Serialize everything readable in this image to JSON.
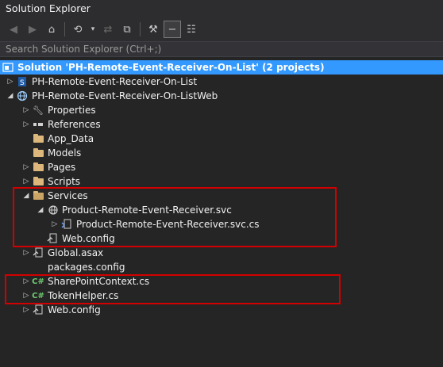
{
  "window": {
    "title": "Solution Explorer"
  },
  "toolbar": {
    "buttons": [
      "back-icon",
      "forward-icon",
      "home-icon",
      "history-icon",
      "sync-icon",
      "collapse-all-icon",
      "properties-icon",
      "show-all-files-icon",
      "class-view-icon"
    ]
  },
  "search": {
    "placeholder": "Search Solution Explorer (Ctrl+;)"
  },
  "tree": {
    "items": [
      {
        "label": "Solution 'PH-Remote-Event-Receiver-On-List' (2 projects)",
        "icon": "solution-icon",
        "expand": "none",
        "selected": true
      },
      {
        "label": "PH-Remote-Event-Receiver-On-List",
        "icon": "sharepoint-project-icon",
        "expand": "collapsed"
      },
      {
        "label": "PH-Remote-Event-Receiver-On-ListWeb",
        "icon": "web-project-icon",
        "expand": "expanded"
      },
      {
        "label": "Properties",
        "icon": "wrench-icon",
        "expand": "collapsed"
      },
      {
        "label": "References",
        "icon": "references-icon",
        "expand": "collapsed"
      },
      {
        "label": "App_Data",
        "icon": "folder-icon",
        "expand": "none"
      },
      {
        "label": "Models",
        "icon": "folder-icon",
        "expand": "none"
      },
      {
        "label": "Pages",
        "icon": "folder-icon",
        "expand": "collapsed"
      },
      {
        "label": "Scripts",
        "icon": "folder-icon",
        "expand": "collapsed"
      },
      {
        "label": "Services",
        "icon": "folder-open-icon",
        "expand": "expanded"
      },
      {
        "label": "Product-Remote-Event-Receiver.svc",
        "icon": "service-icon",
        "expand": "expanded"
      },
      {
        "label": "Product-Remote-Event-Receiver.svc.cs",
        "icon": "code-file-icon",
        "expand": "collapsed"
      },
      {
        "label": "Web.config",
        "icon": "config-icon",
        "expand": "none"
      },
      {
        "label": "Global.asax",
        "icon": "config-icon",
        "expand": "collapsed"
      },
      {
        "label": "packages.config",
        "icon": "file-icon",
        "expand": "none"
      },
      {
        "label": "SharePointContext.cs",
        "icon": "csharp-icon",
        "expand": "collapsed"
      },
      {
        "label": "TokenHelper.cs",
        "icon": "csharp-icon",
        "expand": "collapsed"
      },
      {
        "label": "Web.config",
        "icon": "config-icon",
        "expand": "collapsed"
      }
    ]
  },
  "colors": {
    "background": "#252526",
    "selection": "#3399ff",
    "highlight_box": "#d20000",
    "folder": "#dcb67a"
  }
}
